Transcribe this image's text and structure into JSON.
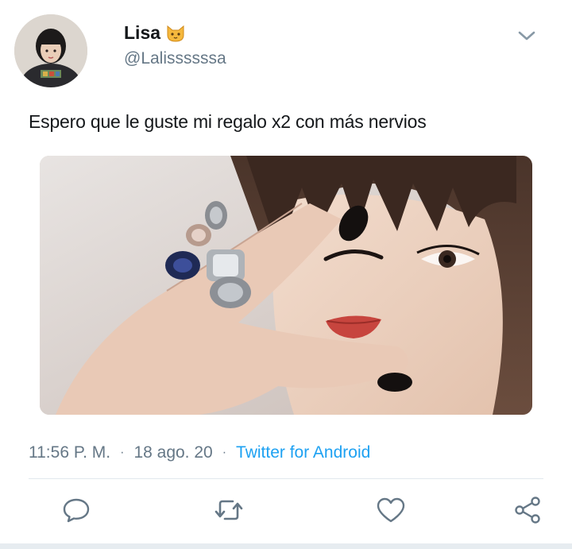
{
  "author": {
    "display_name": "Lisa",
    "name_emoji": "cat-face-emoji",
    "handle": "@Lalissssssa"
  },
  "tweet": {
    "text": "Espero que le guste mi regalo x2 con más nervios",
    "time": "11:56 P. M.",
    "separator_1": "·",
    "date": "18 ago. 20",
    "separator_2": "·",
    "source": "Twitter for Android"
  },
  "icons": {
    "menu": "chevron-down-icon",
    "reply": "reply-icon",
    "retweet": "retweet-icon",
    "like": "heart-icon",
    "share": "share-icon"
  },
  "colors": {
    "text_primary": "#14171a",
    "text_secondary": "#657786",
    "link": "#1da1f2",
    "icon": "#657786",
    "divider": "#e1e8ed"
  }
}
